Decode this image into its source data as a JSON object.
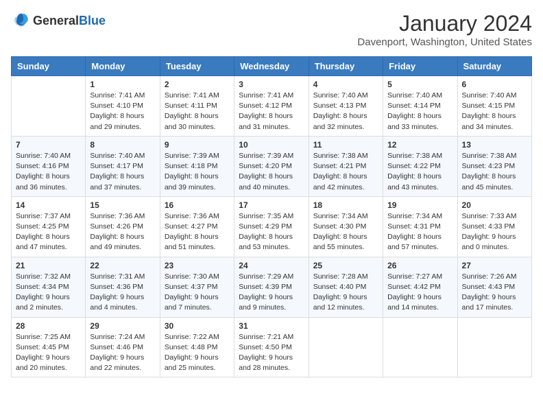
{
  "header": {
    "logo_general": "General",
    "logo_blue": "Blue",
    "month": "January 2024",
    "location": "Davenport, Washington, United States"
  },
  "days_of_week": [
    "Sunday",
    "Monday",
    "Tuesday",
    "Wednesday",
    "Thursday",
    "Friday",
    "Saturday"
  ],
  "weeks": [
    [
      {
        "day": "",
        "sunrise": "",
        "sunset": "",
        "daylight": ""
      },
      {
        "day": "1",
        "sunrise": "Sunrise: 7:41 AM",
        "sunset": "Sunset: 4:10 PM",
        "daylight": "Daylight: 8 hours and 29 minutes."
      },
      {
        "day": "2",
        "sunrise": "Sunrise: 7:41 AM",
        "sunset": "Sunset: 4:11 PM",
        "daylight": "Daylight: 8 hours and 30 minutes."
      },
      {
        "day": "3",
        "sunrise": "Sunrise: 7:41 AM",
        "sunset": "Sunset: 4:12 PM",
        "daylight": "Daylight: 8 hours and 31 minutes."
      },
      {
        "day": "4",
        "sunrise": "Sunrise: 7:40 AM",
        "sunset": "Sunset: 4:13 PM",
        "daylight": "Daylight: 8 hours and 32 minutes."
      },
      {
        "day": "5",
        "sunrise": "Sunrise: 7:40 AM",
        "sunset": "Sunset: 4:14 PM",
        "daylight": "Daylight: 8 hours and 33 minutes."
      },
      {
        "day": "6",
        "sunrise": "Sunrise: 7:40 AM",
        "sunset": "Sunset: 4:15 PM",
        "daylight": "Daylight: 8 hours and 34 minutes."
      }
    ],
    [
      {
        "day": "7",
        "sunrise": "Sunrise: 7:40 AM",
        "sunset": "Sunset: 4:16 PM",
        "daylight": "Daylight: 8 hours and 36 minutes."
      },
      {
        "day": "8",
        "sunrise": "Sunrise: 7:40 AM",
        "sunset": "Sunset: 4:17 PM",
        "daylight": "Daylight: 8 hours and 37 minutes."
      },
      {
        "day": "9",
        "sunrise": "Sunrise: 7:39 AM",
        "sunset": "Sunset: 4:18 PM",
        "daylight": "Daylight: 8 hours and 39 minutes."
      },
      {
        "day": "10",
        "sunrise": "Sunrise: 7:39 AM",
        "sunset": "Sunset: 4:20 PM",
        "daylight": "Daylight: 8 hours and 40 minutes."
      },
      {
        "day": "11",
        "sunrise": "Sunrise: 7:38 AM",
        "sunset": "Sunset: 4:21 PM",
        "daylight": "Daylight: 8 hours and 42 minutes."
      },
      {
        "day": "12",
        "sunrise": "Sunrise: 7:38 AM",
        "sunset": "Sunset: 4:22 PM",
        "daylight": "Daylight: 8 hours and 43 minutes."
      },
      {
        "day": "13",
        "sunrise": "Sunrise: 7:38 AM",
        "sunset": "Sunset: 4:23 PM",
        "daylight": "Daylight: 8 hours and 45 minutes."
      }
    ],
    [
      {
        "day": "14",
        "sunrise": "Sunrise: 7:37 AM",
        "sunset": "Sunset: 4:25 PM",
        "daylight": "Daylight: 8 hours and 47 minutes."
      },
      {
        "day": "15",
        "sunrise": "Sunrise: 7:36 AM",
        "sunset": "Sunset: 4:26 PM",
        "daylight": "Daylight: 8 hours and 49 minutes."
      },
      {
        "day": "16",
        "sunrise": "Sunrise: 7:36 AM",
        "sunset": "Sunset: 4:27 PM",
        "daylight": "Daylight: 8 hours and 51 minutes."
      },
      {
        "day": "17",
        "sunrise": "Sunrise: 7:35 AM",
        "sunset": "Sunset: 4:29 PM",
        "daylight": "Daylight: 8 hours and 53 minutes."
      },
      {
        "day": "18",
        "sunrise": "Sunrise: 7:34 AM",
        "sunset": "Sunset: 4:30 PM",
        "daylight": "Daylight: 8 hours and 55 minutes."
      },
      {
        "day": "19",
        "sunrise": "Sunrise: 7:34 AM",
        "sunset": "Sunset: 4:31 PM",
        "daylight": "Daylight: 8 hours and 57 minutes."
      },
      {
        "day": "20",
        "sunrise": "Sunrise: 7:33 AM",
        "sunset": "Sunset: 4:33 PM",
        "daylight": "Daylight: 9 hours and 0 minutes."
      }
    ],
    [
      {
        "day": "21",
        "sunrise": "Sunrise: 7:32 AM",
        "sunset": "Sunset: 4:34 PM",
        "daylight": "Daylight: 9 hours and 2 minutes."
      },
      {
        "day": "22",
        "sunrise": "Sunrise: 7:31 AM",
        "sunset": "Sunset: 4:36 PM",
        "daylight": "Daylight: 9 hours and 4 minutes."
      },
      {
        "day": "23",
        "sunrise": "Sunrise: 7:30 AM",
        "sunset": "Sunset: 4:37 PM",
        "daylight": "Daylight: 9 hours and 7 minutes."
      },
      {
        "day": "24",
        "sunrise": "Sunrise: 7:29 AM",
        "sunset": "Sunset: 4:39 PM",
        "daylight": "Daylight: 9 hours and 9 minutes."
      },
      {
        "day": "25",
        "sunrise": "Sunrise: 7:28 AM",
        "sunset": "Sunset: 4:40 PM",
        "daylight": "Daylight: 9 hours and 12 minutes."
      },
      {
        "day": "26",
        "sunrise": "Sunrise: 7:27 AM",
        "sunset": "Sunset: 4:42 PM",
        "daylight": "Daylight: 9 hours and 14 minutes."
      },
      {
        "day": "27",
        "sunrise": "Sunrise: 7:26 AM",
        "sunset": "Sunset: 4:43 PM",
        "daylight": "Daylight: 9 hours and 17 minutes."
      }
    ],
    [
      {
        "day": "28",
        "sunrise": "Sunrise: 7:25 AM",
        "sunset": "Sunset: 4:45 PM",
        "daylight": "Daylight: 9 hours and 20 minutes."
      },
      {
        "day": "29",
        "sunrise": "Sunrise: 7:24 AM",
        "sunset": "Sunset: 4:46 PM",
        "daylight": "Daylight: 9 hours and 22 minutes."
      },
      {
        "day": "30",
        "sunrise": "Sunrise: 7:22 AM",
        "sunset": "Sunset: 4:48 PM",
        "daylight": "Daylight: 9 hours and 25 minutes."
      },
      {
        "day": "31",
        "sunrise": "Sunrise: 7:21 AM",
        "sunset": "Sunset: 4:50 PM",
        "daylight": "Daylight: 9 hours and 28 minutes."
      },
      {
        "day": "",
        "sunrise": "",
        "sunset": "",
        "daylight": ""
      },
      {
        "day": "",
        "sunrise": "",
        "sunset": "",
        "daylight": ""
      },
      {
        "day": "",
        "sunrise": "",
        "sunset": "",
        "daylight": ""
      }
    ]
  ]
}
